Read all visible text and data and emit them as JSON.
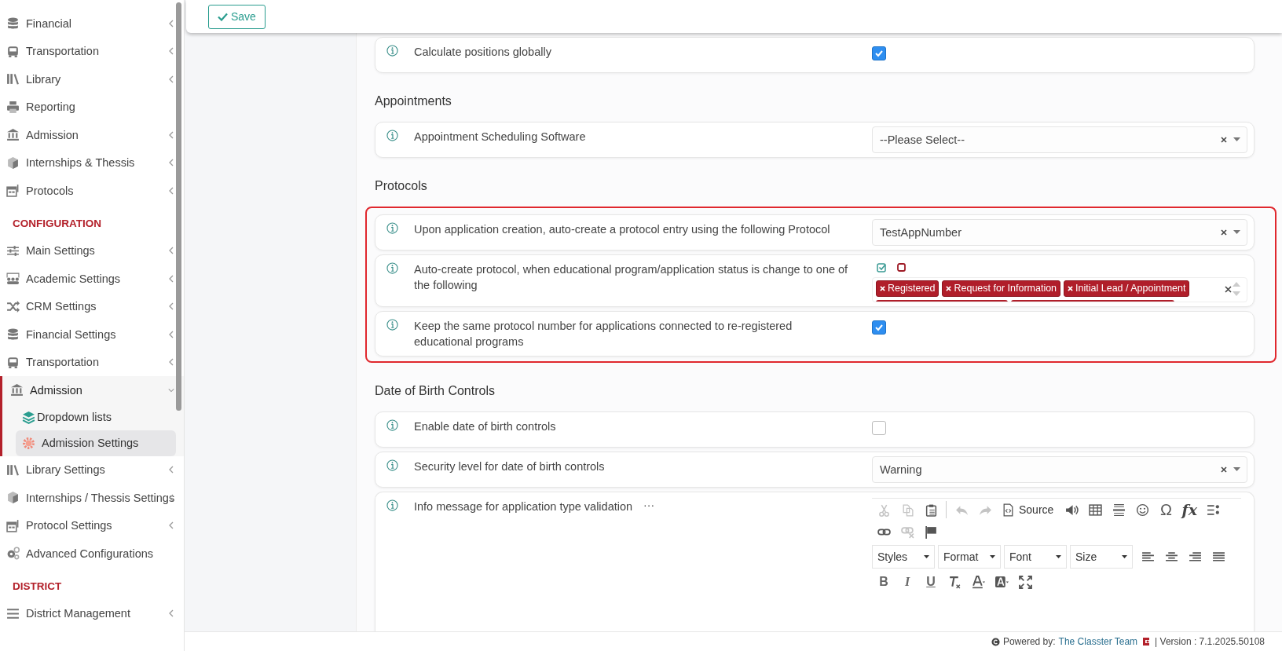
{
  "sidebar": {
    "sections": [
      {
        "items": [
          {
            "label": "Financial",
            "kind": "group",
            "expanded": false
          },
          {
            "label": "Transportation",
            "kind": "group",
            "expanded": false
          },
          {
            "label": "Library",
            "kind": "group",
            "expanded": false
          },
          {
            "label": "Reporting",
            "kind": "link"
          },
          {
            "label": "Admission",
            "kind": "group",
            "expanded": false
          },
          {
            "label": "Internships & Thessis",
            "kind": "group",
            "expanded": false
          },
          {
            "label": "Protocols",
            "kind": "group",
            "expanded": false
          }
        ]
      },
      {
        "heading": "CONFIGURATION",
        "items": [
          {
            "label": "Main Settings",
            "kind": "group",
            "expanded": false
          },
          {
            "label": "Academic Settings",
            "kind": "group",
            "expanded": false
          },
          {
            "label": "CRM Settings",
            "kind": "group",
            "expanded": false
          },
          {
            "label": "Financial Settings",
            "kind": "group",
            "expanded": false
          },
          {
            "label": "Transportation",
            "kind": "group",
            "expanded": false
          },
          {
            "label": "Admission",
            "kind": "group",
            "expanded": true,
            "children": [
              {
                "label": "Dropdown lists",
                "selected": false
              },
              {
                "label": "Admission Settings",
                "selected": true
              }
            ]
          },
          {
            "label": "Library Settings",
            "kind": "group",
            "expanded": false
          },
          {
            "label": "Internships / Thessis Settings",
            "kind": "group",
            "expanded": false
          },
          {
            "label": "Protocol Settings",
            "kind": "group",
            "expanded": false
          },
          {
            "label": "Advanced Configurations",
            "kind": "link"
          }
        ]
      },
      {
        "heading": "DISTRICT",
        "items": [
          {
            "label": "District Management",
            "kind": "group",
            "expanded": false
          }
        ]
      }
    ]
  },
  "save_button": {
    "label": "Save"
  },
  "sections": [
    {
      "highlighted": false,
      "settings": [
        {
          "kind": "checkbox",
          "label": "Calculate positions globally",
          "checked": true
        }
      ]
    },
    {
      "title": "Appointments",
      "highlighted": false,
      "settings": [
        {
          "kind": "select",
          "label": "Appointment Scheduling Software",
          "placeholder": "--Please Select--"
        }
      ]
    },
    {
      "title": "Protocols",
      "highlighted": true,
      "settings": [
        {
          "kind": "select",
          "label": "Upon application creation, auto-create a protocol entry using the following Protocol",
          "value": "TestAppNumber"
        },
        {
          "kind": "multiselect",
          "label": "Auto-create protocol, when educational program/application status is change to one of the following",
          "tags": [
            "Registered",
            "Request for Information",
            "Initial Lead / Appointment"
          ]
        },
        {
          "kind": "checkbox",
          "label": "Keep the same protocol number for applications connected to re-registered educational programs",
          "checked": true
        }
      ]
    },
    {
      "title": "Date of Birth Controls",
      "highlighted": false,
      "settings": [
        {
          "kind": "checkbox",
          "label": "Enable date of birth controls",
          "checked": false
        },
        {
          "kind": "select",
          "label": "Security level for date of birth controls",
          "value": "Warning"
        },
        {
          "kind": "editor",
          "label": "Info message for application type validation",
          "more": "···",
          "toolbar": [
            [
              {
                "kind": "icon",
                "disabled": true
              },
              {
                "kind": "icon",
                "disabled": true
              },
              {
                "kind": "icon",
                "disabled": false
              },
              {
                "kind": "separator"
              },
              {
                "kind": "icon",
                "disabled": true
              },
              {
                "kind": "icon",
                "disabled": true
              },
              {
                "kind": "source",
                "label": "Source"
              },
              {
                "kind": "icon",
                "disabled": false
              },
              {
                "kind": "icon",
                "disabled": false
              },
              {
                "kind": "icon",
                "disabled": false
              },
              {
                "kind": "icon",
                "disabled": false
              },
              {
                "kind": "glyph",
                "label": "Ω"
              },
              {
                "kind": "formula",
                "label": "fx"
              },
              {
                "kind": "icon",
                "disabled": false
              }
            ],
            [
              {
                "kind": "icon",
                "disabled": false
              },
              {
                "kind": "icon",
                "disabled": true
              },
              {
                "kind": "icon",
                "disabled": false
              }
            ],
            [
              {
                "kind": "dropdown",
                "label": "Styles"
              },
              {
                "kind": "dropdown",
                "label": "Format"
              },
              {
                "kind": "dropdown",
                "label": "Font"
              },
              {
                "kind": "dropdown",
                "label": "Size"
              },
              {
                "kind": "icon",
                "disabled": false
              },
              {
                "kind": "icon",
                "disabled": false
              },
              {
                "kind": "icon",
                "disabled": false
              },
              {
                "kind": "icon",
                "disabled": false
              }
            ],
            [
              {
                "kind": "bold",
                "label": "B"
              },
              {
                "kind": "italic",
                "label": "I"
              },
              {
                "kind": "underline",
                "label": "U"
              },
              {
                "kind": "icon",
                "disabled": false
              },
              {
                "kind": "icon",
                "disabled": false
              },
              {
                "kind": "icon",
                "disabled": false
              },
              {
                "kind": "icon",
                "disabled": false
              }
            ]
          ]
        }
      ]
    }
  ],
  "footer": {
    "powered_by": "Powered by:",
    "team": "The Classter Team",
    "version": "| Version : 7.1.2025.50108"
  }
}
